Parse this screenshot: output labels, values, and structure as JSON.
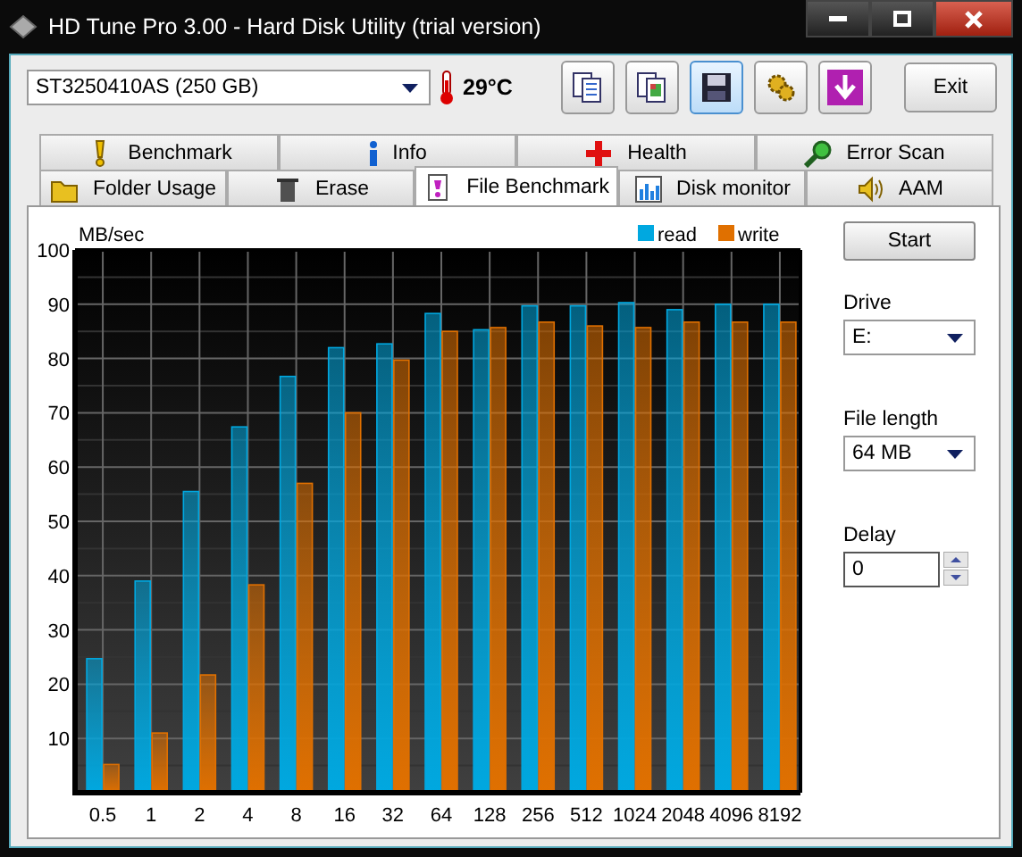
{
  "window": {
    "title": "HD Tune Pro 3.00 - Hard Disk Utility (trial version)"
  },
  "toolbar": {
    "drive": "ST3250410AS (250 GB)",
    "temperature": "29°C",
    "exit": "Exit"
  },
  "tab_rows": [
    {
      "tabs": [
        {
          "label": "Benchmark",
          "selected": false
        },
        {
          "label": "Info",
          "selected": false
        },
        {
          "label": "Health",
          "selected": false
        },
        {
          "label": "Error Scan",
          "selected": false
        }
      ]
    },
    {
      "tabs": [
        {
          "label": "Folder Usage",
          "selected": false
        },
        {
          "label": "Erase",
          "selected": false
        },
        {
          "label": "File Benchmark",
          "selected": true
        },
        {
          "label": "Disk monitor",
          "selected": false
        },
        {
          "label": "AAM",
          "selected": false
        }
      ]
    }
  ],
  "chart_data": {
    "type": "bar",
    "grid": true,
    "legend": "top-right",
    "ylabel": "MB/sec",
    "categories": [
      "0.5",
      "1",
      "2",
      "4",
      "8",
      "16",
      "32",
      "64",
      "128",
      "256",
      "512",
      "1024",
      "2048",
      "4096",
      "8192"
    ],
    "ylim": [
      0,
      100
    ],
    "yticks": [
      10,
      20,
      30,
      40,
      50,
      60,
      70,
      80,
      90,
      100
    ],
    "series": [
      {
        "name": "read",
        "color": "#00a8e0",
        "values": [
          24.7,
          39,
          55.5,
          67.4,
          76.7,
          82,
          82.7,
          88.3,
          85.3,
          89.7,
          89.7,
          90.3,
          89,
          90,
          90
        ]
      },
      {
        "name": "write",
        "color": "#e07000",
        "values": [
          5.2,
          11,
          21.7,
          38.3,
          57,
          70,
          79.7,
          85,
          85.7,
          86.7,
          86,
          85.7,
          86.7,
          86.7,
          86.7
        ]
      }
    ]
  },
  "controls": {
    "start": "Start",
    "drive_label": "Drive",
    "drive": "E:",
    "file_length_label": "File length",
    "file_length": "64 MB",
    "delay_label": "Delay",
    "delay": "0"
  }
}
